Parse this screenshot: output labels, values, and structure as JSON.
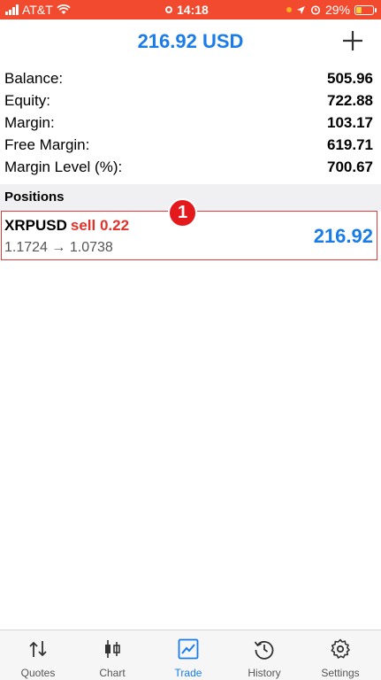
{
  "status_bar": {
    "carrier": "AT&T",
    "time": "14:18",
    "battery": "29%",
    "accent": "#f24a2e"
  },
  "header": {
    "title": "216.92 USD",
    "add_icon": "plus-icon"
  },
  "summary": [
    {
      "label": "Balance:",
      "value": "505.96"
    },
    {
      "label": "Equity:",
      "value": "722.88"
    },
    {
      "label": "Margin:",
      "value": "103.17"
    },
    {
      "label": "Free Margin:",
      "value": "619.71"
    },
    {
      "label": "Margin Level (%):",
      "value": "700.67"
    }
  ],
  "positions": {
    "heading": "Positions",
    "badge": "1",
    "items": [
      {
        "symbol": "XRPUSD",
        "side": "sell 0.22",
        "open_price": "1.1724",
        "arrow": "→",
        "current_price": "1.0738",
        "profit": "216.92"
      }
    ]
  },
  "tabs": [
    {
      "label": "Quotes",
      "icon": "quotes-arrows-icon",
      "active": false
    },
    {
      "label": "Chart",
      "icon": "candlestick-chart-icon",
      "active": false
    },
    {
      "label": "Trade",
      "icon": "trade-chart-icon",
      "active": true
    },
    {
      "label": "History",
      "icon": "history-clock-icon",
      "active": false
    },
    {
      "label": "Settings",
      "icon": "gear-icon",
      "active": false
    }
  ],
  "colors": {
    "brand_blue": "#1a7ce8",
    "sell_red": "#e0332b",
    "highlight_red": "#e23b3b"
  }
}
